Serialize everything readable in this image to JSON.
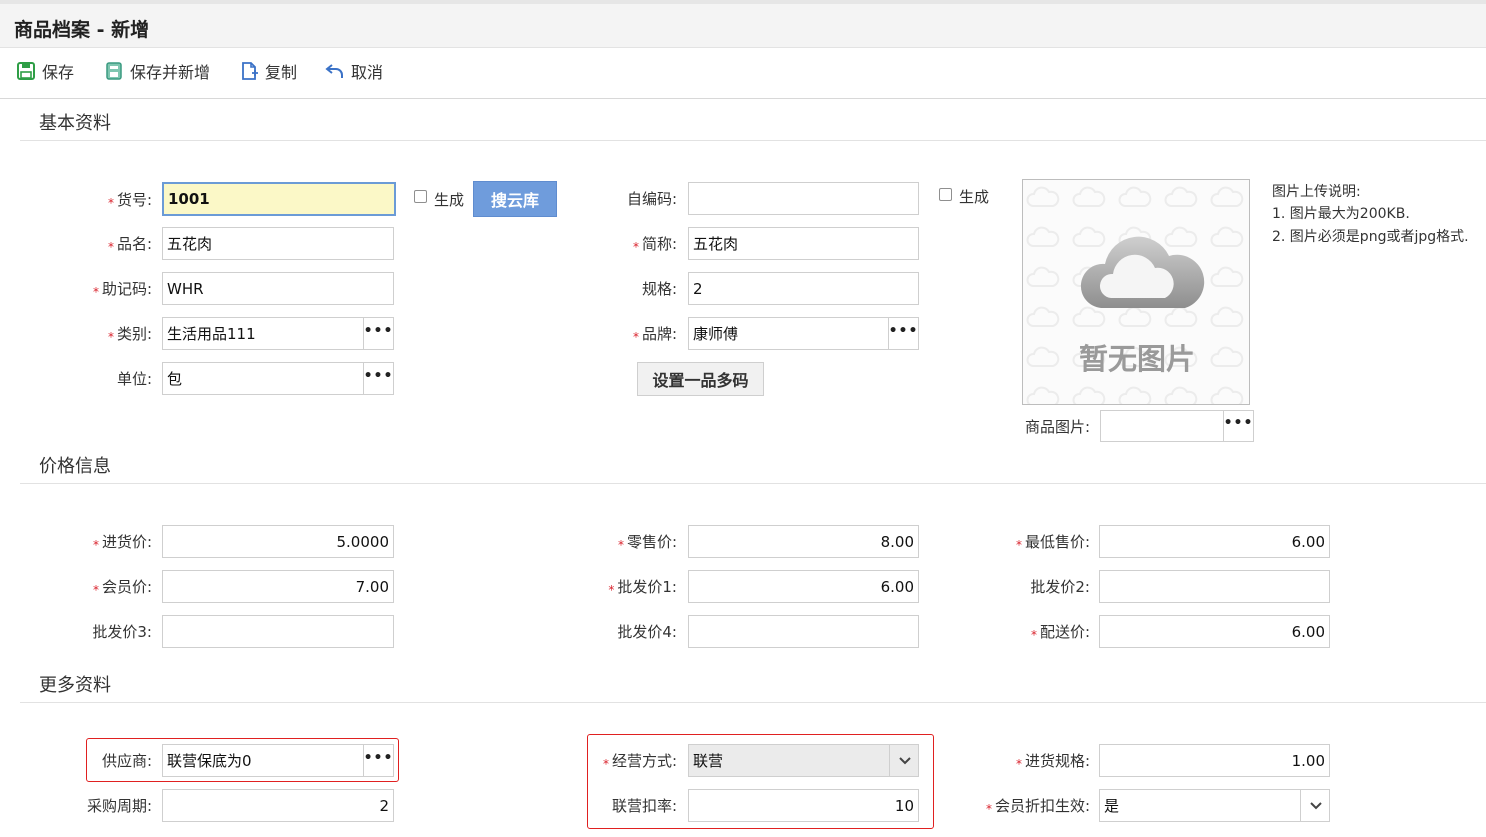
{
  "window": {
    "title": "商品档案 - 新增"
  },
  "toolbar": {
    "save": "保存",
    "save_new": "保存并新增",
    "copy": "复制",
    "cancel": "取消"
  },
  "sections": {
    "basic": "基本资料",
    "price": "价格信息",
    "more": "更多资料"
  },
  "basic": {
    "item_no": {
      "label": "货号:",
      "value": "1001"
    },
    "gen1_label": "生成",
    "search_cloud": "搜云库",
    "self_code": {
      "label": "自编码:",
      "value": ""
    },
    "gen2_label": "生成",
    "name": {
      "label": "品名:",
      "value": "五花肉"
    },
    "short_name": {
      "label": "简称:",
      "value": "五花肉"
    },
    "mnemonic": {
      "label": "助记码:",
      "value": "WHR"
    },
    "spec": {
      "label": "规格:",
      "value": "2"
    },
    "category": {
      "label": "类别:",
      "value": "生活用品111"
    },
    "brand": {
      "label": "品牌:",
      "value": "康师傅"
    },
    "unit": {
      "label": "单位:",
      "value": "包"
    },
    "multi_code": "设置一品多码",
    "image_placeholder": "暂无图片",
    "image_field": {
      "label": "商品图片:",
      "value": ""
    },
    "upload_notes": [
      "图片上传说明:",
      "1. 图片最大为200KB.",
      "2. 图片必须是png或者jpg格式."
    ]
  },
  "price": {
    "purchase": {
      "label": "进货价:",
      "value": "5.0000"
    },
    "retail": {
      "label": "零售价:",
      "value": "8.00"
    },
    "min_sale": {
      "label": "最低售价:",
      "value": "6.00"
    },
    "member": {
      "label": "会员价:",
      "value": "7.00"
    },
    "wholesale1": {
      "label": "批发价1:",
      "value": "6.00"
    },
    "wholesale2": {
      "label": "批发价2:",
      "value": ""
    },
    "wholesale3": {
      "label": "批发价3:",
      "value": ""
    },
    "wholesale4": {
      "label": "批发价4:",
      "value": ""
    },
    "delivery": {
      "label": "配送价:",
      "value": "6.00"
    }
  },
  "more": {
    "supplier": {
      "label": "供应商:",
      "value": "联营保底为0"
    },
    "business_mode": {
      "label": "经营方式:",
      "value": "联营"
    },
    "purchase_spec": {
      "label": "进货规格:",
      "value": "1.00"
    },
    "purchase_cycle": {
      "label": "采购周期:",
      "value": "2"
    },
    "joint_rate": {
      "label": "联营扣率:",
      "value": "10"
    },
    "member_discount": {
      "label": "会员折扣生效:",
      "value": "是"
    }
  },
  "colors": {
    "accent": "#6f9cdc",
    "required": "#d9232d",
    "highlight_box": "#e02020",
    "focus_bg": "#fbf8c7"
  }
}
